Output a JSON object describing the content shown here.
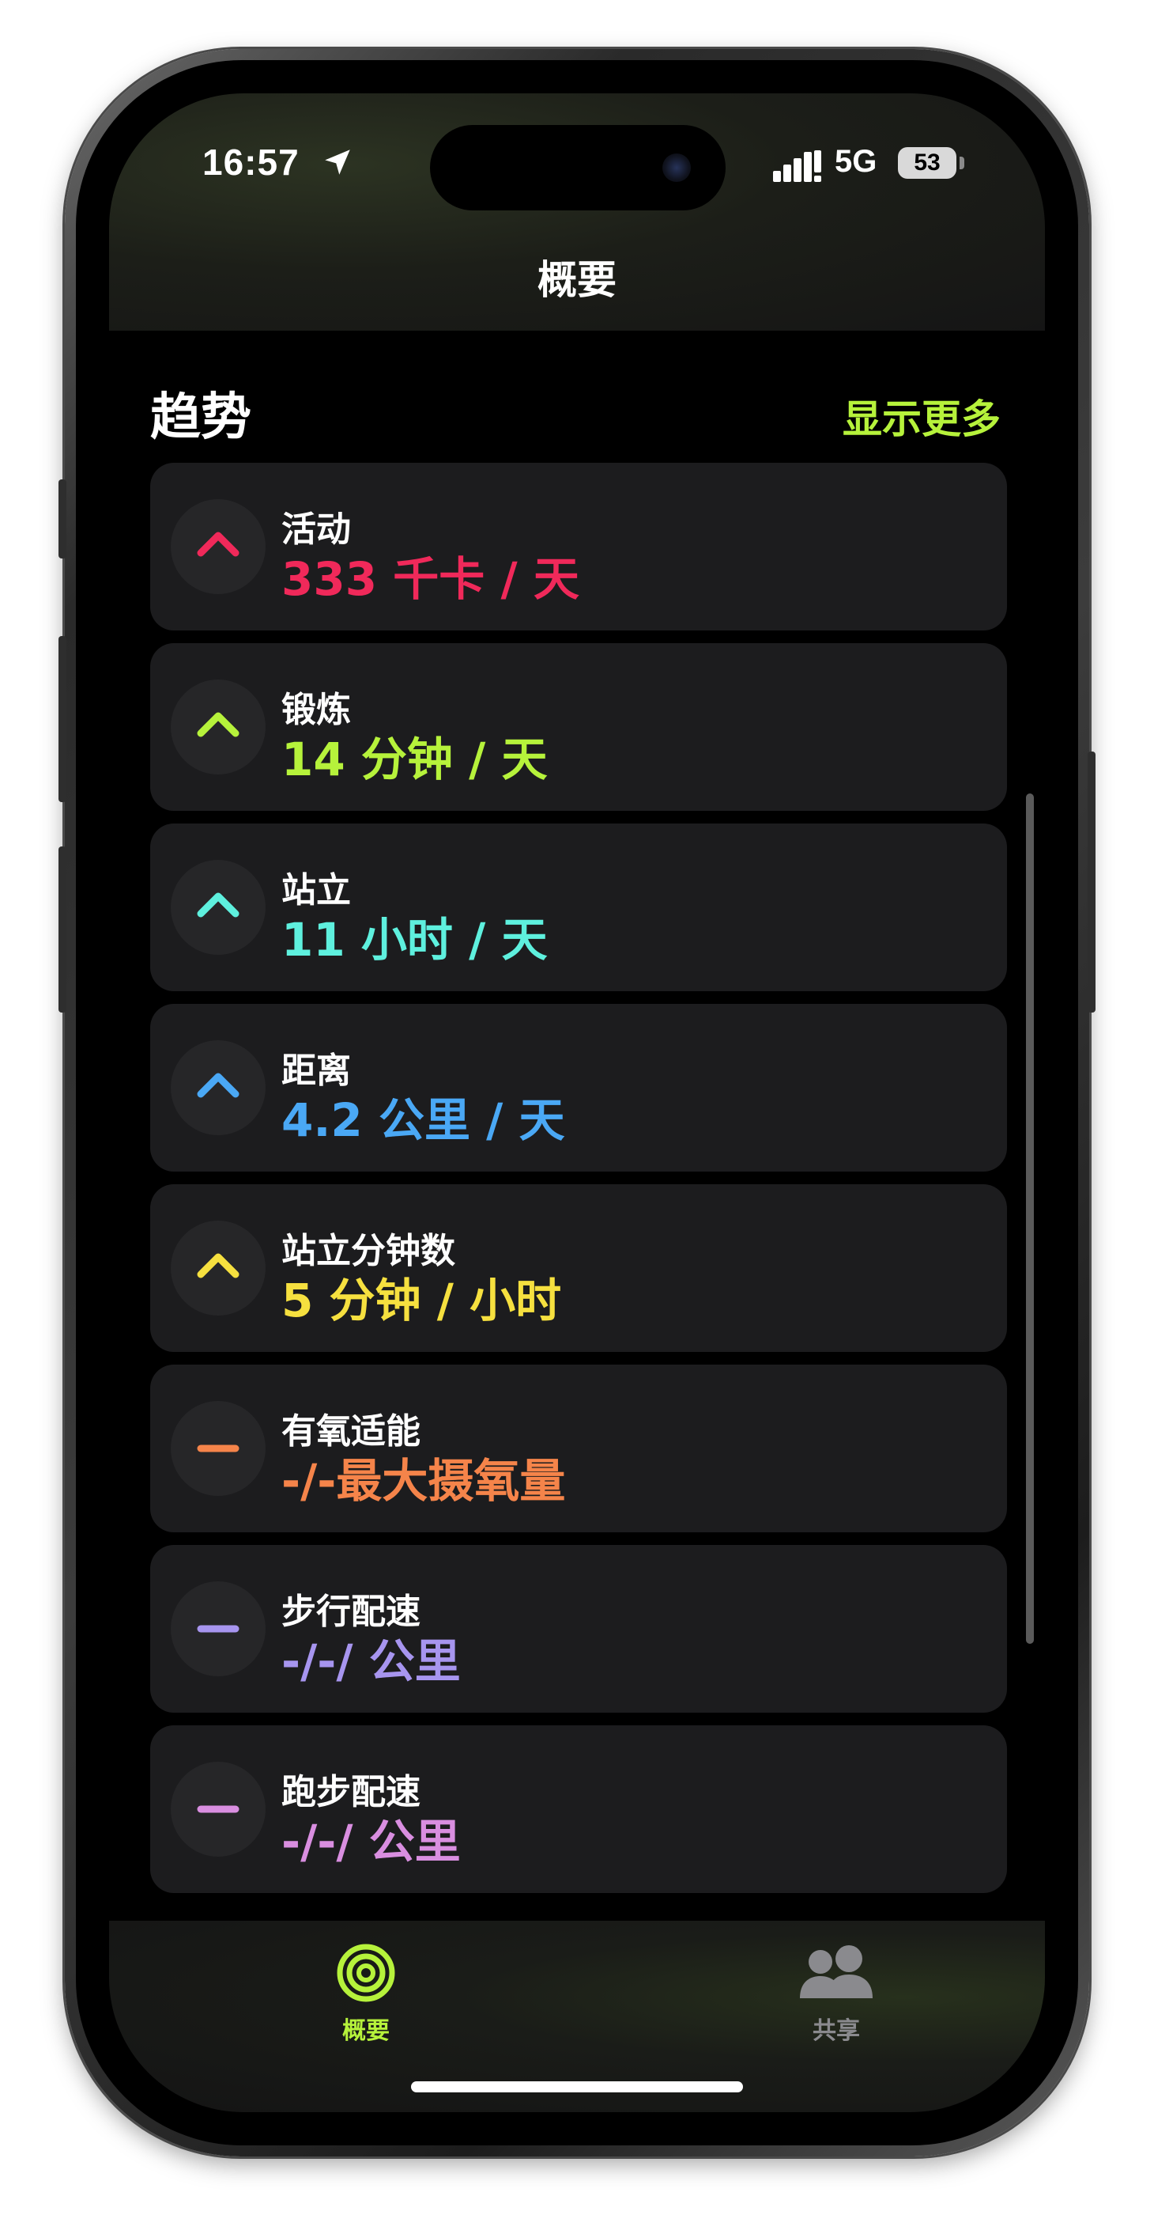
{
  "status_bar": {
    "time": "16:57",
    "network": "5G",
    "battery": "53"
  },
  "nav": {
    "title": "概要"
  },
  "section": {
    "title": "趋势",
    "show_more": "显示更多"
  },
  "trends": [
    {
      "label": "活动",
      "value": "333 千卡 / 天",
      "color": "#f0295a",
      "trend": "up"
    },
    {
      "label": "锻炼",
      "value": "14 分钟 / 天",
      "color": "#b6f23b",
      "trend": "up"
    },
    {
      "label": "站立",
      "value": "11 小时 / 天",
      "color": "#5ef0de",
      "trend": "up"
    },
    {
      "label": "距离",
      "value": "4.2 公里 / 天",
      "color": "#4aa8f5",
      "trend": "up"
    },
    {
      "label": "站立分钟数",
      "value": "5 分钟 / 小时",
      "color": "#f6e03f",
      "trend": "up"
    },
    {
      "label": "有氧适能",
      "value": "-/-最大摄氧量",
      "color": "#f5844a",
      "trend": "flat"
    },
    {
      "label": "步行配速",
      "value": "-/-/ 公里",
      "color": "#a795ef",
      "trend": "flat"
    },
    {
      "label": "跑步配速",
      "value": "-/-/ 公里",
      "color": "#d98ee0",
      "trend": "flat"
    }
  ],
  "tabs": {
    "summary": {
      "label": "概要",
      "icon": "activity-rings-icon",
      "color": "#b6f23b",
      "active": true
    },
    "sharing": {
      "label": "共享",
      "icon": "people-icon",
      "color": "#8a8a8e",
      "active": false
    }
  }
}
